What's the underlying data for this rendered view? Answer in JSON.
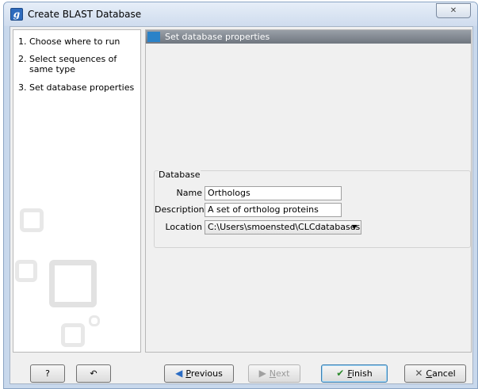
{
  "window": {
    "title": "Create BLAST Database",
    "app_icon_glyph": "g",
    "close_glyph": "✕"
  },
  "steps": [
    {
      "num": "1.",
      "label": "Choose where to run"
    },
    {
      "num": "2.",
      "label": "Select sequences of same type"
    },
    {
      "num": "3.",
      "label": "Set database properties"
    }
  ],
  "section": {
    "title": "Set database properties"
  },
  "database": {
    "group_title": "Database",
    "name_label": "Name",
    "name_value": "Orthologs",
    "description_label": "Description",
    "description_value": "A set of ortholog proteins",
    "location_label": "Location",
    "location_value": "C:\\Users\\smoensted\\CLCdatabases"
  },
  "buttons": {
    "help": "?",
    "reset_icon": "reset-icon",
    "previous_first": "P",
    "previous_rest": "revious",
    "next_first": "N",
    "next_rest": "ext",
    "finish_first": "F",
    "finish_rest": "inish",
    "cancel_first": "C",
    "cancel_rest": "ancel"
  },
  "colors": {
    "section_marker": "#2a82c8",
    "finish_check": "#2d8a2d",
    "previous_arrow": "#2a6cc4"
  }
}
